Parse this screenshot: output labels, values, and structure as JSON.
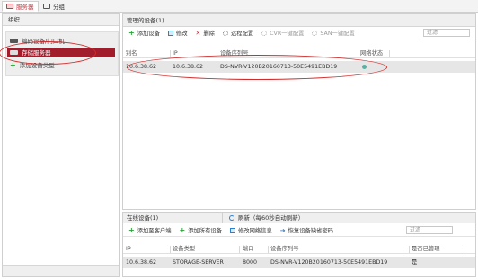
{
  "tabs": [
    {
      "label": "服务器",
      "active": true
    },
    {
      "label": "分组",
      "active": false
    }
  ],
  "sidebar": {
    "title": "组织",
    "items": [
      {
        "label": "编码设备/门口机"
      },
      {
        "label": "存储服务器",
        "selected": true
      },
      {
        "label": "添加设备类型"
      }
    ]
  },
  "managed": {
    "title": "管理的设备(1)",
    "toolbar": {
      "add": "添加设备",
      "modify": "修改",
      "delete": "删除",
      "remote_config": "远程配置",
      "cvr": "CVR一键配置",
      "san": "SAN一键配置"
    },
    "filter_placeholder": "过滤",
    "columns": [
      "别名",
      "IP",
      "设备序列号",
      "网络状态"
    ],
    "rows": [
      {
        "alias": "10.6.38.62",
        "ip": "10.6.38.62",
        "serial": "DS-NVR-V120B20160713-50E5491EBD19",
        "status_icon": "network-online-icon"
      }
    ]
  },
  "online": {
    "title": "在线设备(1)",
    "refresh": "刷新（每60秒自动刷新）",
    "toolbar": {
      "add_client": "添加至客户端",
      "add_all": "添加所有设备",
      "modify_net": "修改网络信息",
      "restore_pwd": "恢复设备缺省密码"
    },
    "filter_placeholder": "过滤",
    "columns": [
      "IP",
      "设备类型",
      "端口",
      "设备序列号",
      "是否已管理"
    ],
    "rows": [
      {
        "ip": "10.6.38.62",
        "type": "STORAGE-SERVER",
        "port": "8000",
        "serial": "DS-NVR-V120B20160713-50E5491EBD19",
        "managed": "是"
      }
    ]
  },
  "colors": {
    "accent": "#d0363f",
    "selected_bg": "#a11d2c",
    "annotation": "#d12b2b",
    "green": "#2e9b3a"
  }
}
